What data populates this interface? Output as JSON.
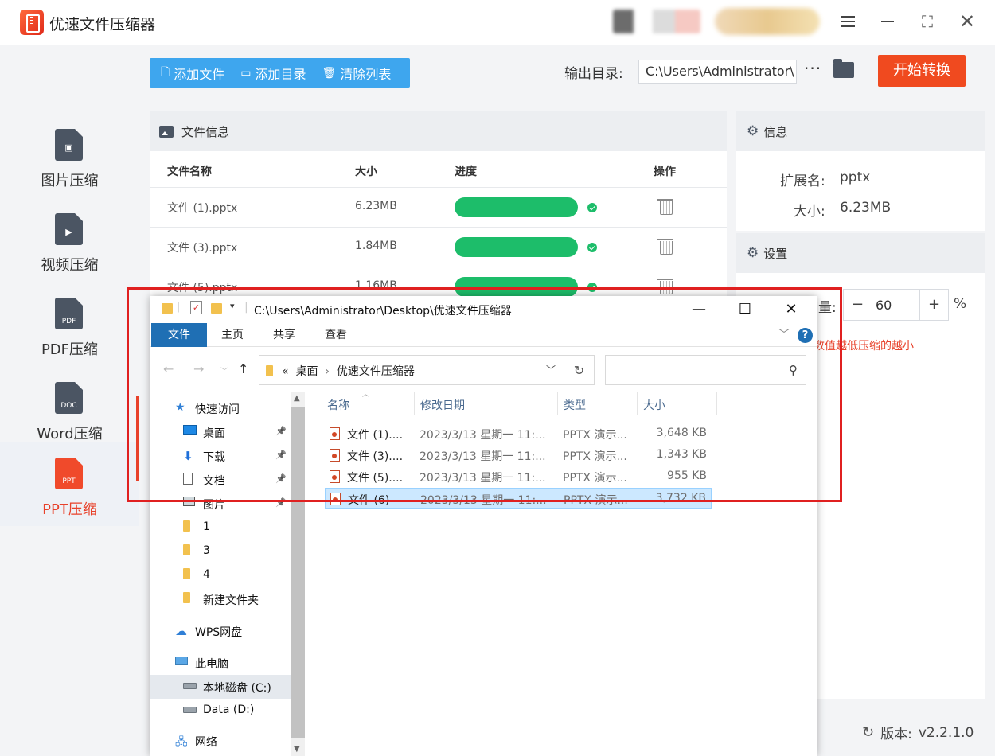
{
  "app": {
    "title": "优速文件压缩器"
  },
  "nav": {
    "items": [
      {
        "label": "图片压缩",
        "icon": "image-file-icon",
        "doc": ""
      },
      {
        "label": "视频压缩",
        "icon": "video-file-icon",
        "doc": ""
      },
      {
        "label": "PDF压缩",
        "icon": "pdf-file-icon",
        "doc": "PDF"
      },
      {
        "label": "Word压缩",
        "icon": "doc-file-icon",
        "doc": "DOC"
      },
      {
        "label": "PPT压缩",
        "icon": "ppt-file-icon",
        "doc": "PPT"
      }
    ],
    "active_index": 4
  },
  "toolbar": {
    "add_file": "添加文件",
    "add_dir": "添加目录",
    "clear_list": "清除列表",
    "output_label": "输出目录:",
    "output_path": "C:\\Users\\Administrator\\",
    "more": "···",
    "start": "开始转换"
  },
  "file_panel": {
    "title": "文件信息",
    "columns": {
      "name": "文件名称",
      "size": "大小",
      "progress": "进度",
      "action": "操作"
    },
    "rows": [
      {
        "name": "文件 (1).pptx",
        "size": "6.23MB",
        "progress": 1.0
      },
      {
        "name": "文件 (3).pptx",
        "size": "1.84MB",
        "progress": 1.0
      },
      {
        "name": "文件 (5).pptx",
        "size": "1.16MB",
        "progress": 1.0
      }
    ]
  },
  "info_panel": {
    "title": "信息",
    "ext_label": "扩展名:",
    "ext_value": "pptx",
    "size_label": "大小:",
    "size_value": "6.23MB"
  },
  "settings": {
    "title": "设置",
    "quality_label_partial": "量:",
    "quality_value": "60",
    "unit": "%",
    "hint_partial": "数值越低压缩的越小"
  },
  "version": {
    "label": "版本:",
    "value": "v2.2.1.0"
  },
  "explorer": {
    "title_path": "C:\\Users\\Administrator\\Desktop\\优速文件压缩器",
    "ribbon_tabs": [
      "文件",
      "主页",
      "共享",
      "查看"
    ],
    "breadcrumb": {
      "prefix": "«",
      "parts": [
        "桌面",
        "优速文件压缩器"
      ]
    },
    "search_placeholder": "",
    "tree": [
      {
        "label": "快速访问",
        "icon": "star-icon",
        "indent": 0,
        "pinned": false
      },
      {
        "label": "桌面",
        "icon": "desktop-icon",
        "indent": 1,
        "pinned": true
      },
      {
        "label": "下载",
        "icon": "download-icon",
        "indent": 1,
        "pinned": true
      },
      {
        "label": "文档",
        "icon": "document-icon",
        "indent": 1,
        "pinned": true
      },
      {
        "label": "图片",
        "icon": "picture-icon",
        "indent": 1,
        "pinned": true
      },
      {
        "label": "1",
        "icon": "folder-icon",
        "indent": 1,
        "pinned": false
      },
      {
        "label": "3",
        "icon": "folder-icon",
        "indent": 1,
        "pinned": false
      },
      {
        "label": "4",
        "icon": "folder-icon",
        "indent": 1,
        "pinned": false
      },
      {
        "label": "新建文件夹",
        "icon": "folder-icon",
        "indent": 1,
        "pinned": false
      },
      {
        "label": "WPS网盘",
        "icon": "cloud-icon",
        "indent": 0,
        "pinned": false
      },
      {
        "label": "此电脑",
        "icon": "computer-icon",
        "indent": 0,
        "pinned": false
      },
      {
        "label": "本地磁盘 (C:)",
        "icon": "drive-icon",
        "indent": 1,
        "pinned": false,
        "selected": true
      },
      {
        "label": "Data (D:)",
        "icon": "drive-icon",
        "indent": 1,
        "pinned": false
      },
      {
        "label": "网络",
        "icon": "network-icon",
        "indent": 0,
        "pinned": false
      }
    ],
    "columns": {
      "name": "名称",
      "date": "修改日期",
      "type": "类型",
      "size": "大小"
    },
    "files": [
      {
        "name": "文件 (1)....",
        "date": "2023/3/13 星期一 11:...",
        "type": "PPTX 演示...",
        "size": "3,648 KB"
      },
      {
        "name": "文件 (3)....",
        "date": "2023/3/13 星期一 11:...",
        "type": "PPTX 演示...",
        "size": "1,343 KB"
      },
      {
        "name": "文件 (5)....",
        "date": "2023/3/13 星期一 11:...",
        "type": "PPTX 演示...",
        "size": "955 KB"
      },
      {
        "name": "文件 (6)",
        "date": "2023/3/13 星期一 11:...",
        "type": "PPTX 演示...",
        "size": "3,732 KB",
        "selected": true
      }
    ]
  },
  "colors": {
    "accent_red": "#f04a1f",
    "toolbar_blue": "#3ea6ee",
    "progress_green": "#1dbd6a",
    "ribbon_blue": "#1f6fb4",
    "highlight_box": "#e02020"
  }
}
